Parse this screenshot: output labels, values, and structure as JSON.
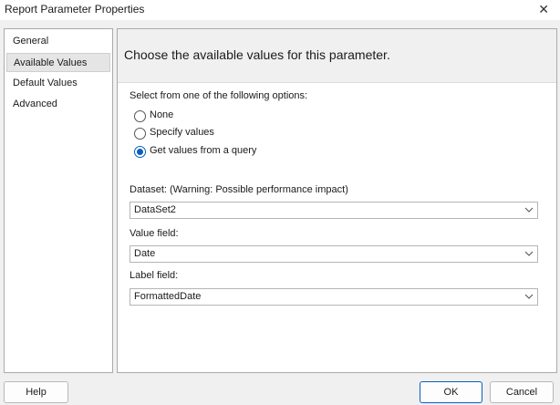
{
  "window": {
    "title": "Report Parameter Properties",
    "close_glyph": "✕"
  },
  "sidebar": {
    "items": [
      {
        "label": "General"
      },
      {
        "label": "Available Values",
        "selected": true
      },
      {
        "label": "Default Values"
      },
      {
        "label": "Advanced"
      }
    ]
  },
  "main": {
    "heading": "Choose the available values for this parameter.",
    "options_label": "Select from one of the following options:",
    "options": [
      {
        "label": "None",
        "checked": false
      },
      {
        "label": "Specify values",
        "checked": false
      },
      {
        "label": "Get values from a query",
        "checked": true
      }
    ],
    "dataset_label": "Dataset: (Warning: Possible performance impact)",
    "dataset_value": "DataSet2",
    "value_field_label": "Value field:",
    "value_field_value": "Date",
    "label_field_label": "Label field:",
    "label_field_value": "FormattedDate"
  },
  "footer": {
    "help_label": "Help",
    "ok_label": "OK",
    "cancel_label": "Cancel"
  },
  "colors": {
    "accent": "#0a5fbf",
    "selected_nav_bg": "#e5e5e5",
    "header_bg": "#f0f0f0"
  }
}
